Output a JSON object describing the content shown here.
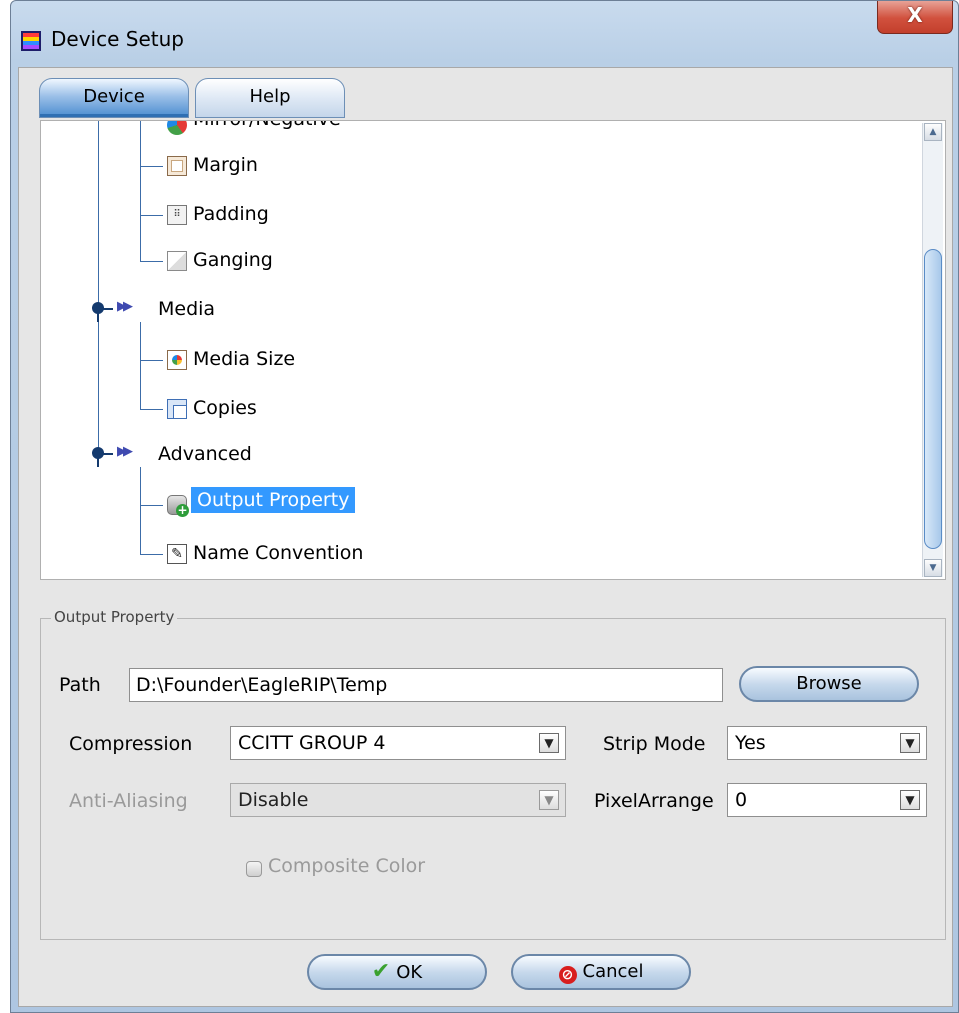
{
  "window": {
    "title": "Device Setup",
    "close_label": "X"
  },
  "tabs": [
    {
      "label": "Device"
    },
    {
      "label": "Help"
    }
  ],
  "tree": {
    "clipped_item": "Mirror/Negative",
    "items": {
      "margin": "Margin",
      "padding": "Padding",
      "ganging": "Ganging",
      "media": "Media",
      "media_size": "Media Size",
      "copies": "Copies",
      "advanced": "Advanced",
      "output_property": "Output Property",
      "name_convention": "Name Convention"
    },
    "selected": "Output Property"
  },
  "output_property": {
    "group_title": "Output Property",
    "path_label": "Path",
    "path_value": "D:\\Founder\\EagleRIP\\Temp",
    "browse_label": "Browse",
    "compression_label": "Compression",
    "compression_value": "CCITT GROUP 4",
    "strip_mode_label": "Strip Mode",
    "strip_mode_value": "Yes",
    "anti_aliasing_label": "Anti-Aliasing",
    "anti_aliasing_value": "Disable",
    "pixel_arrange_label": "PixelArrange",
    "pixel_arrange_value": "0",
    "composite_color_label": "Composite Color"
  },
  "buttons": {
    "ok": "OK",
    "cancel": "Cancel"
  }
}
